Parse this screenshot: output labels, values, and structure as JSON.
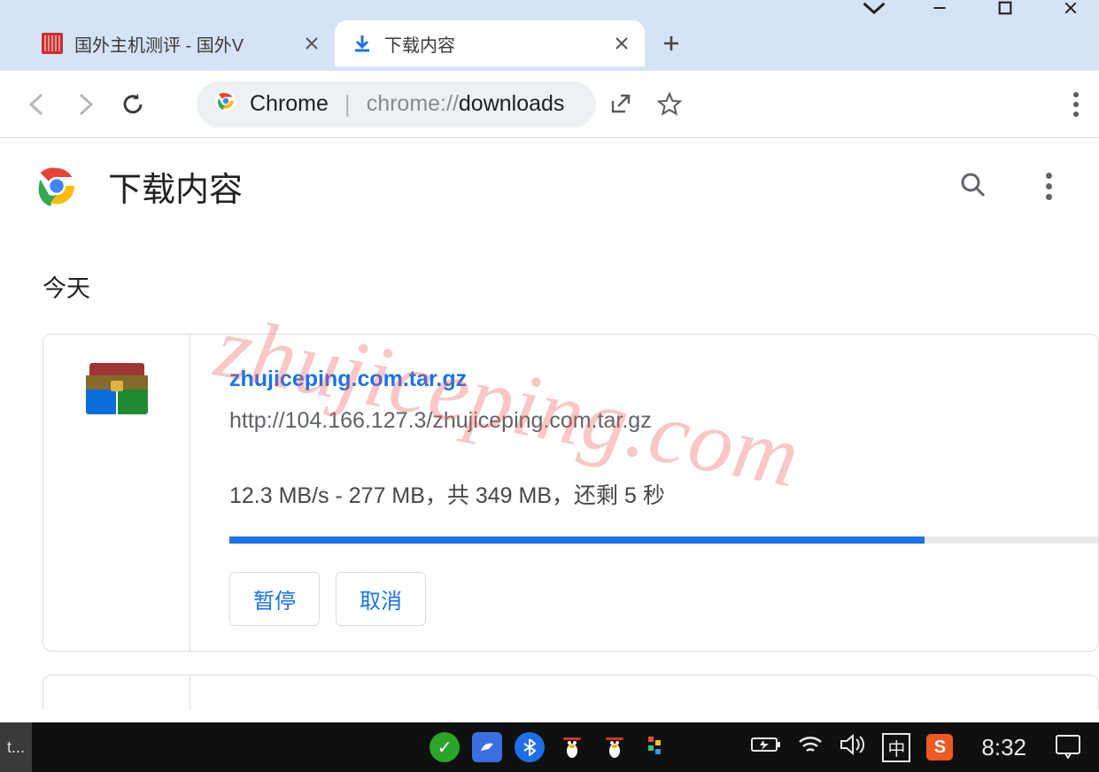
{
  "window": {
    "tabs": [
      {
        "title": "国外主机测评 - 国外V",
        "active": false
      },
      {
        "title": "下载内容",
        "active": true
      }
    ],
    "address": {
      "prefix": "Chrome",
      "scheme": "chrome://",
      "path_bold": "downloads"
    }
  },
  "page": {
    "title": "下载内容",
    "section_label": "今天",
    "download": {
      "filename": "zhujiceping.com.tar.gz",
      "url": "http://104.166.127.3/zhujiceping.com.tar.gz",
      "status": "12.3 MB/s - 277 MB，共 349 MB，还剩 5 秒",
      "progress_pct": 80,
      "pause_label": "暂停",
      "cancel_label": "取消"
    }
  },
  "watermark": "zhujiceping.com",
  "taskbar": {
    "left_label": "t...",
    "clock": "8:32",
    "ime": "中"
  }
}
